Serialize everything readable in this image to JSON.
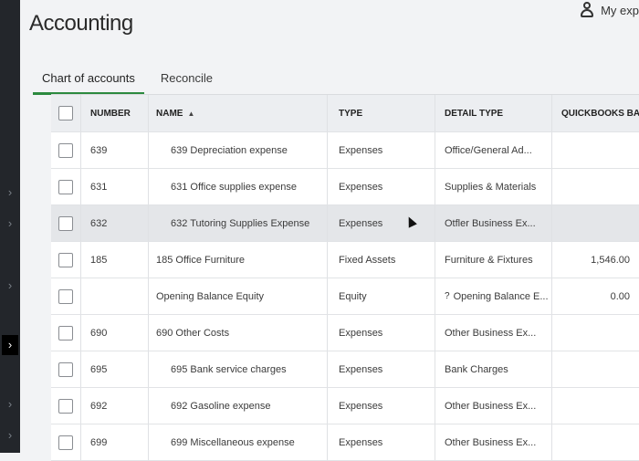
{
  "page": {
    "title": "Accounting"
  },
  "user": {
    "label": "My exp"
  },
  "tabs": [
    {
      "label": "Chart of accounts"
    },
    {
      "label": "Reconcile"
    }
  ],
  "columns": {
    "number": "NUMBER",
    "name": "NAME",
    "type": "TYPE",
    "detail": "DETAIL TYPE",
    "balance": "QUICKBOOKS BAL"
  },
  "rows": [
    {
      "number": "639",
      "name": "639 Depreciation expense",
      "type": "Expenses",
      "detail": "Office/General Ad...",
      "balance": ""
    },
    {
      "number": "631",
      "name": "631 Office supplies expense",
      "type": "Expenses",
      "detail": "Supplies & Materials",
      "balance": ""
    },
    {
      "number": "632",
      "name": "632 Tutoring Supplies Expense",
      "type": "Expenses",
      "detail": "Otfler Business Ex...",
      "balance": ""
    },
    {
      "number": "185",
      "name": "185 Office Furniture",
      "type": "Fixed Assets",
      "detail": "Furniture & Fixtures",
      "balance": "1,546.00"
    },
    {
      "number": "",
      "name": "Opening Balance Equity",
      "type": "Equity",
      "detail": "Opening Balance E...",
      "detail_prefix": "?",
      "balance": "0.00"
    },
    {
      "number": "690",
      "name": "690 Other Costs",
      "type": "Expenses",
      "detail": "Other Business Ex...",
      "balance": ""
    },
    {
      "number": "695",
      "name": "695 Bank service charges",
      "type": "Expenses",
      "detail": "Bank Charges",
      "balance": ""
    },
    {
      "number": "692",
      "name": "692 Gasoline expense",
      "type": "Expenses",
      "detail": "Other Business Ex...",
      "balance": ""
    },
    {
      "number": "699",
      "name": "699 Miscellaneous expense",
      "type": "Expenses",
      "detail": "Other Business Ex...",
      "balance": ""
    }
  ],
  "icons": {
    "rail": "chevron-right-icon",
    "user": "user-icon",
    "sort": "sort-ascending-icon",
    "cursor": "mouse-cursor-icon"
  },
  "colors": {
    "accent": "#2c8a3f",
    "rail": "#23262b"
  }
}
